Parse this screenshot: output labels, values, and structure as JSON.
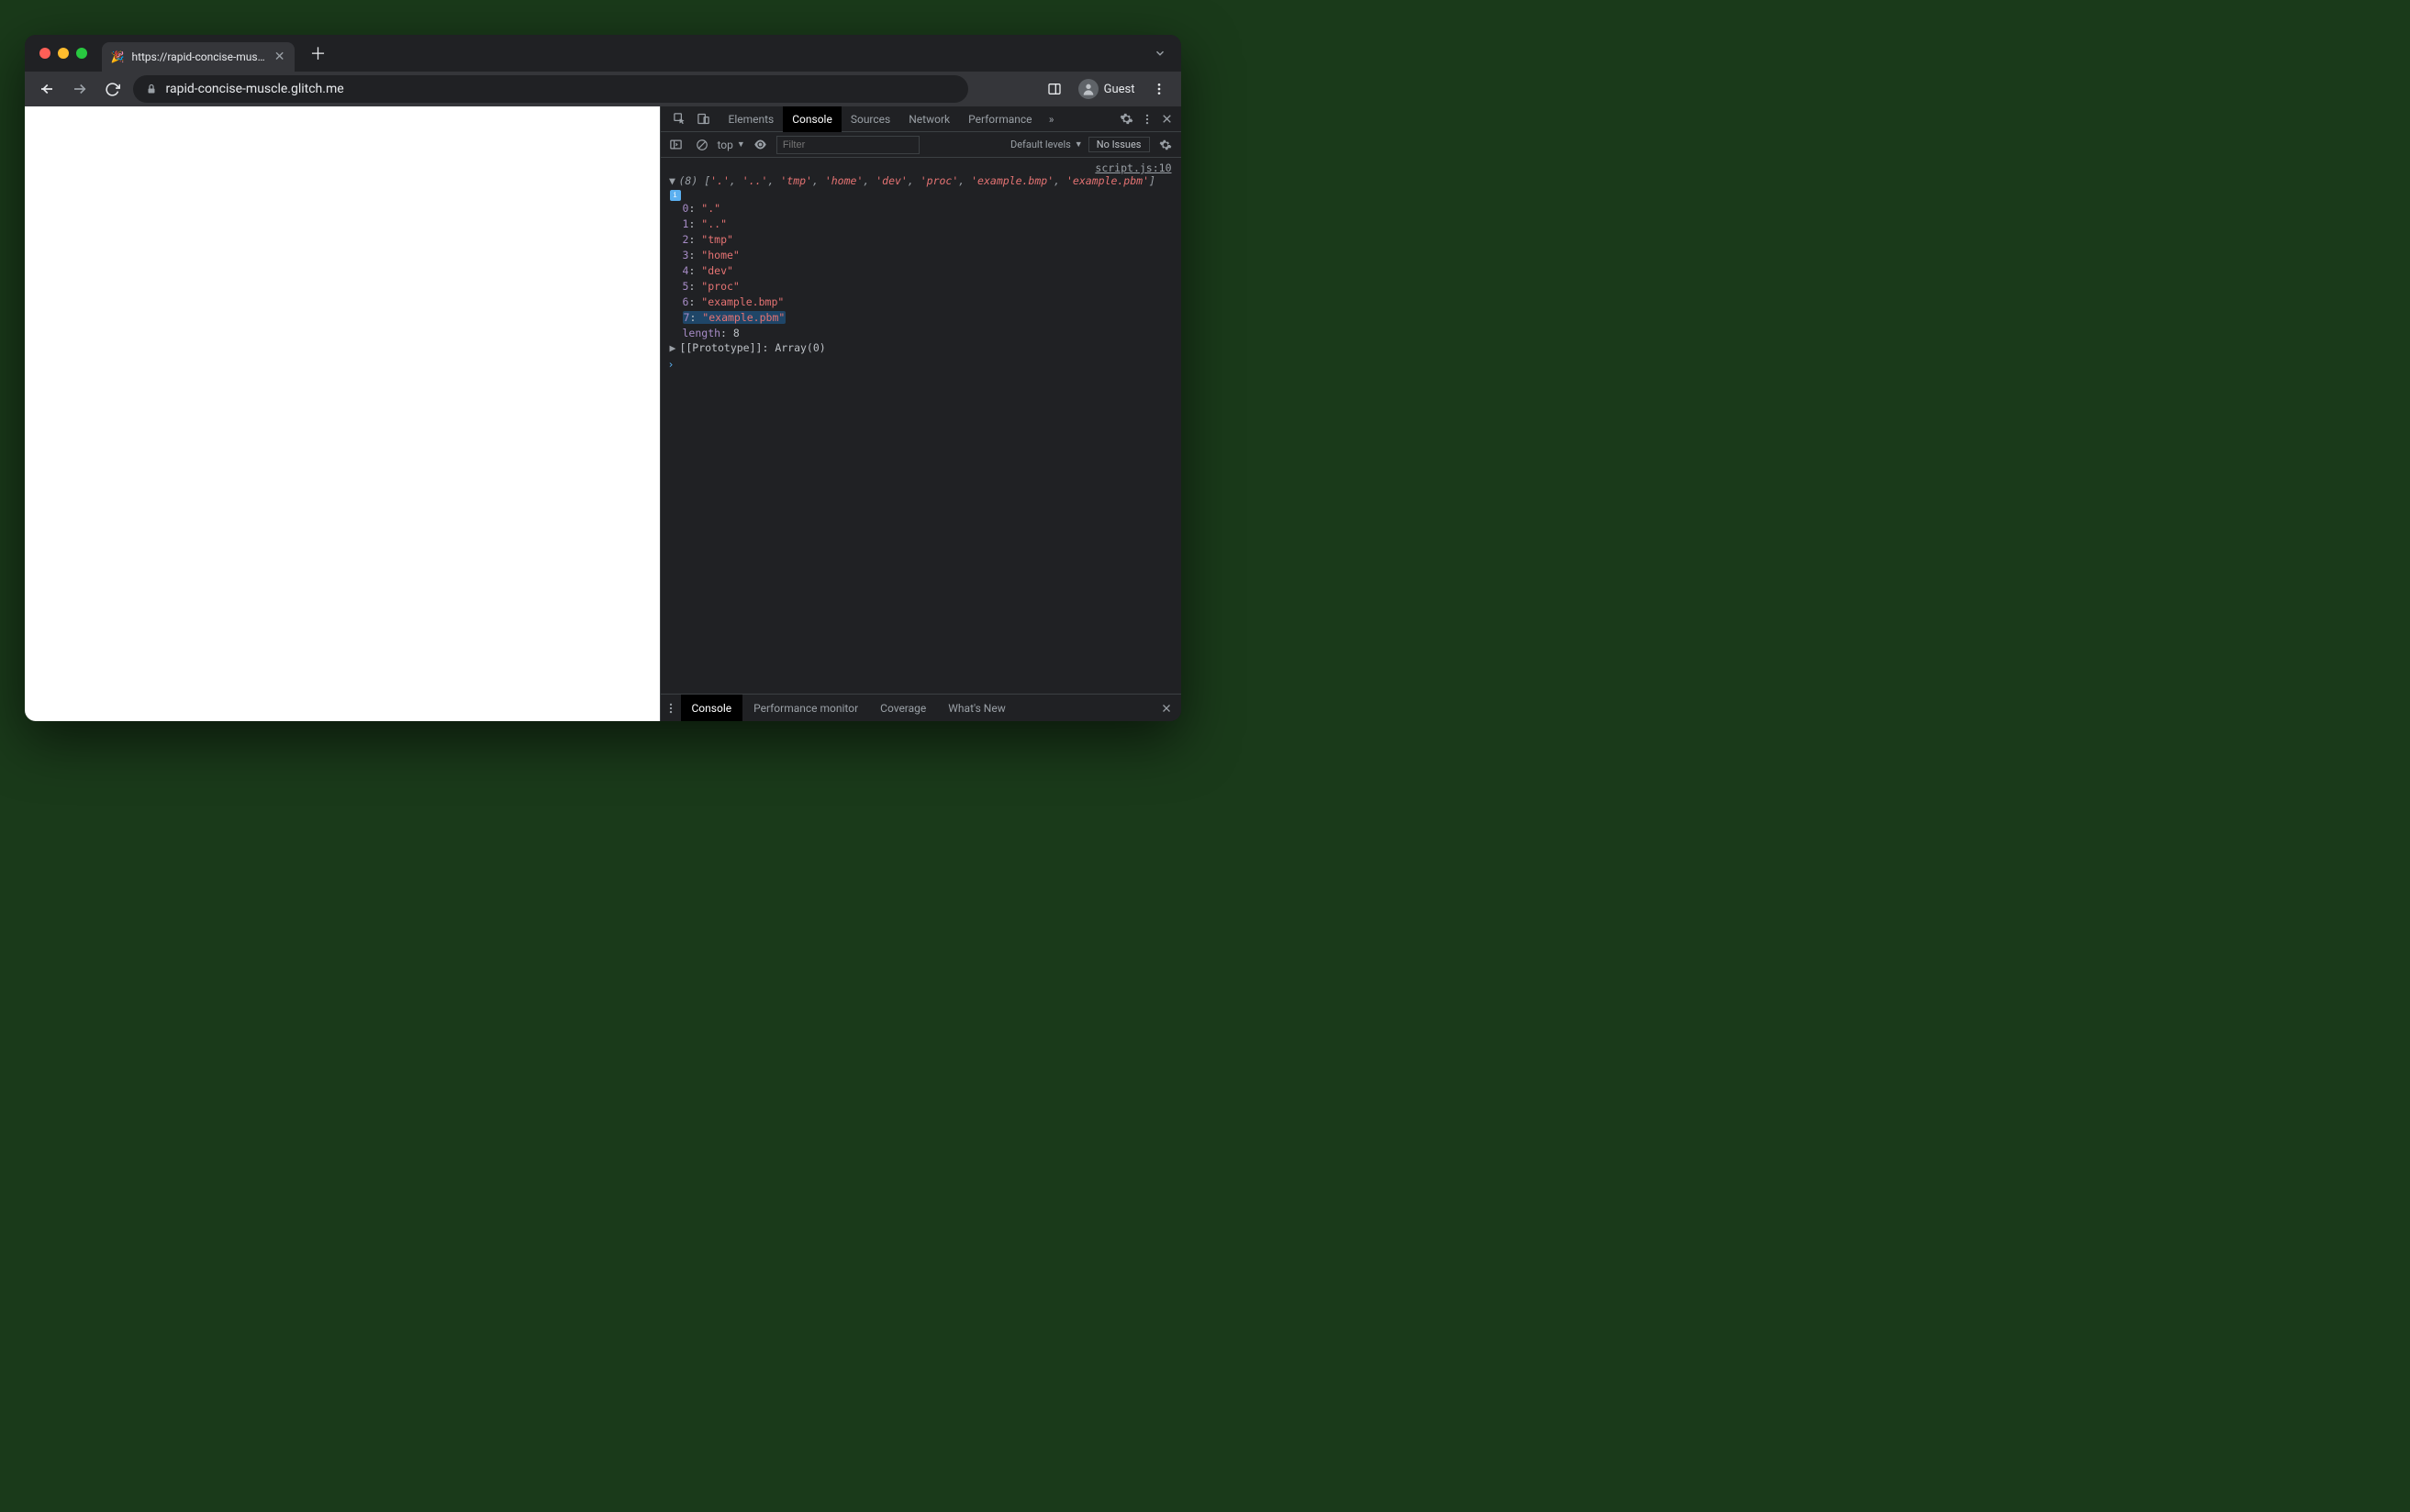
{
  "browser": {
    "tab_title": "https://rapid-concise-muscle.g",
    "url_display": "rapid-concise-muscle.glitch.me",
    "guest_label": "Guest"
  },
  "devtools": {
    "tabs": [
      "Elements",
      "Console",
      "Sources",
      "Network",
      "Performance"
    ],
    "active_tab": "Console",
    "more_symbol": "»"
  },
  "console_toolbar": {
    "context": "top",
    "filter_placeholder": "Filter",
    "levels_label": "Default levels",
    "issues_label": "No Issues"
  },
  "console": {
    "source_link": "script.js:10",
    "array_count": "(8)",
    "summary_items": [
      ".",
      "..",
      "tmp",
      "home",
      "dev",
      "proc",
      "example.bmp",
      "example.pbm"
    ],
    "entries": [
      {
        "i": "0",
        "v": "."
      },
      {
        "i": "1",
        "v": ".."
      },
      {
        "i": "2",
        "v": "tmp"
      },
      {
        "i": "3",
        "v": "home"
      },
      {
        "i": "4",
        "v": "dev"
      },
      {
        "i": "5",
        "v": "proc"
      },
      {
        "i": "6",
        "v": "example.bmp"
      },
      {
        "i": "7",
        "v": "example.pbm"
      }
    ],
    "length_key": "length",
    "length_val": "8",
    "proto_label": "[[Prototype]]",
    "proto_val": "Array(0)"
  },
  "drawer": {
    "tabs": [
      "Console",
      "Performance monitor",
      "Coverage",
      "What's New"
    ],
    "active": "Console"
  }
}
